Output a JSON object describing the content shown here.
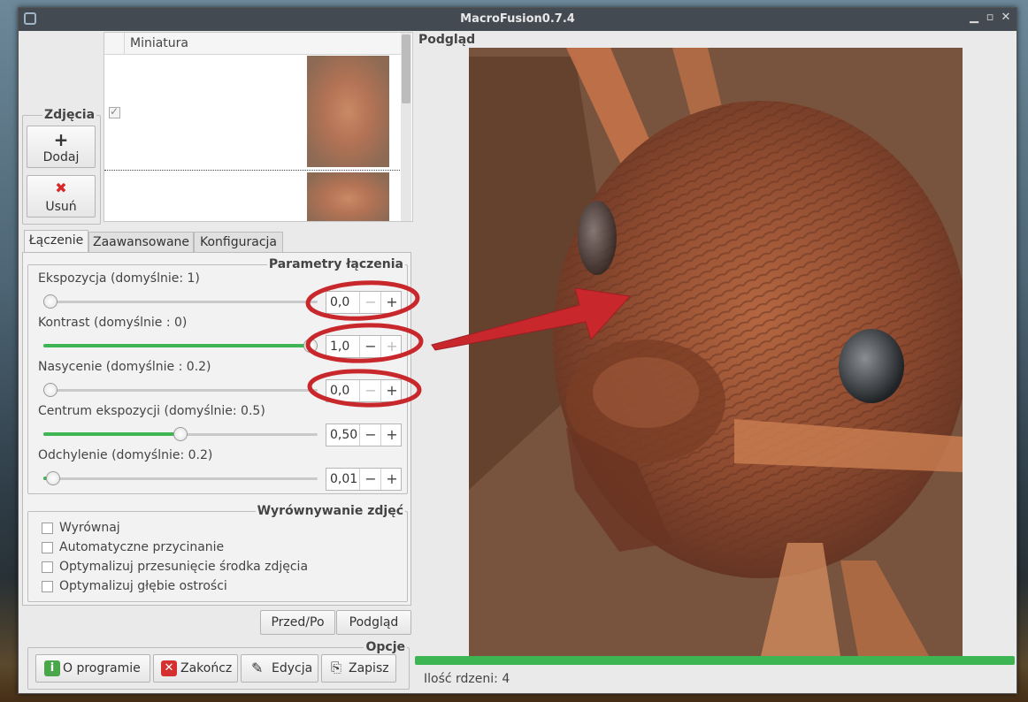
{
  "window": {
    "title": "MacroFusion0.7.4"
  },
  "photos": {
    "legend": "Zdjęcia",
    "add_label": "Dodaj",
    "remove_label": "Usuń",
    "table_header": "Miniatura"
  },
  "tabs": [
    {
      "label": "Łączenie",
      "active": true
    },
    {
      "label": "Zaawansowane",
      "active": false
    },
    {
      "label": "Konfiguracja",
      "active": false
    }
  ],
  "params": {
    "legend": "Parametry łączenia",
    "sliders": [
      {
        "label": "Ekspozycja (domyślnie: 1)",
        "value": "0,0",
        "fraction": 0.0,
        "filled": false,
        "minus_disabled": true,
        "plus_disabled": false
      },
      {
        "label": "Kontrast (domyślnie : 0)",
        "value": "1,0",
        "fraction": 1.0,
        "filled": true,
        "minus_disabled": false,
        "plus_disabled": true
      },
      {
        "label": "Nasycenie (domyślnie : 0.2)",
        "value": "0,0",
        "fraction": 0.0,
        "filled": false,
        "minus_disabled": true,
        "plus_disabled": false
      },
      {
        "label": "Centrum ekspozycji (domyślnie: 0.5)",
        "value": "0,50",
        "fraction": 0.5,
        "filled": true,
        "minus_disabled": false,
        "plus_disabled": false
      },
      {
        "label": "Odchylenie (domyślnie: 0.2)",
        "value": "0,01",
        "fraction": 0.01,
        "filled": true,
        "minus_disabled": false,
        "plus_disabled": false
      }
    ]
  },
  "alignment": {
    "legend": "Wyrównywanie zdjęć",
    "options": [
      {
        "label": "Wyrównaj",
        "checked": false
      },
      {
        "label": "Automatyczne przycinanie",
        "checked": false
      },
      {
        "label": "Optymalizuj przesunięcie środka zdjęcia",
        "checked": false
      },
      {
        "label": "Optymalizuj głębie ostrości",
        "checked": false
      }
    ]
  },
  "view_buttons": {
    "before_after": "Przed/Po",
    "preview": "Podgląd"
  },
  "options": {
    "legend": "Opcje",
    "about": "O programie",
    "quit": "Zakończ",
    "edit": "Edycja",
    "save": "Zapisz"
  },
  "preview": {
    "legend": "Podgląd"
  },
  "status": {
    "cores": "Ilość rdzeni: 4"
  },
  "progress_fraction": 1.0,
  "colors": {
    "accent": "#3cb552",
    "annotation": "#c8282c",
    "titlebar": "#434a52"
  }
}
